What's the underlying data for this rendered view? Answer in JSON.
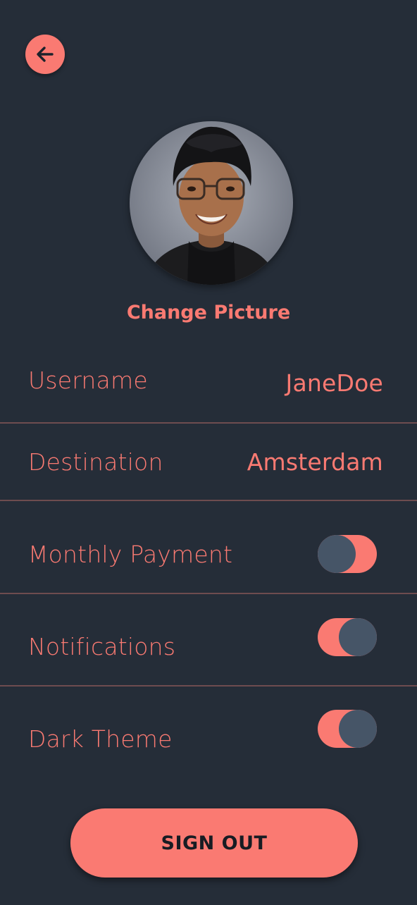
{
  "header": {
    "back_icon": "arrow-left-icon"
  },
  "profile": {
    "avatar_icon": "user-photo",
    "change_picture_label": "Change Picture"
  },
  "settings": {
    "username_label": "Username",
    "username_value": "JaneDoe",
    "destination_label": "Destination",
    "destination_value": "Amsterdam",
    "monthly_payment_label": "Monthly Payment",
    "monthly_payment_on": false,
    "notifications_label": "Notifications",
    "notifications_on": true,
    "dark_theme_label": "Dark Theme",
    "dark_theme_on": true
  },
  "actions": {
    "sign_out_label": "SIGN OUT"
  },
  "colors": {
    "background": "#252d38",
    "accent": "#fa7a72",
    "knob": "#465567",
    "divider": "#6e4c4f"
  }
}
